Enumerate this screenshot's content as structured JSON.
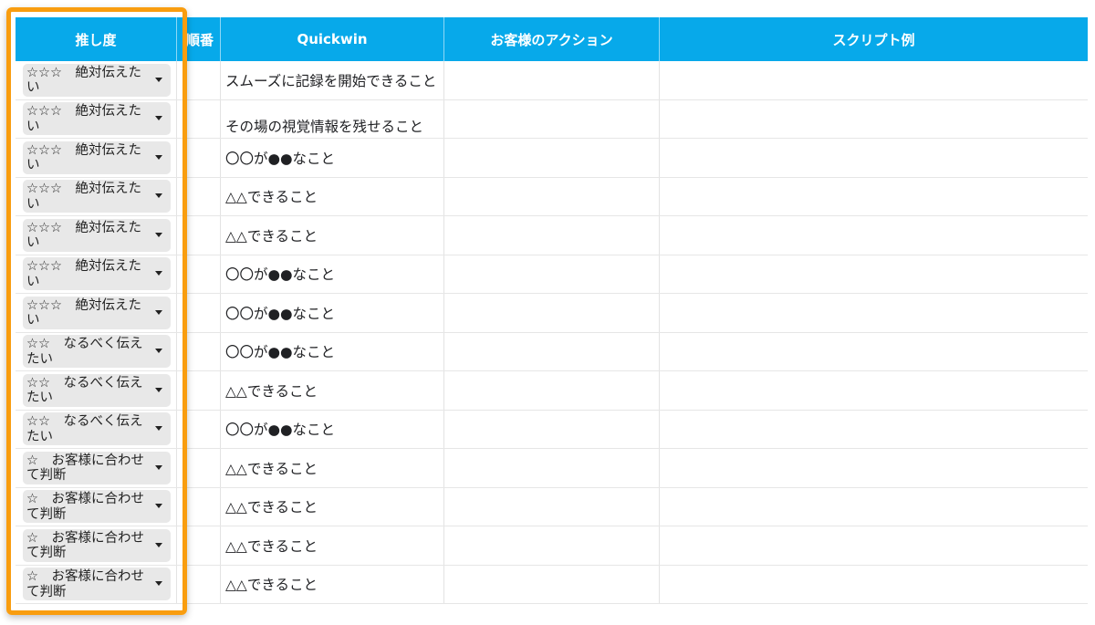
{
  "headers": {
    "priority": "推し度",
    "order": "順番",
    "quickwin": "Quickwin",
    "customer_action": "お客様のアクション",
    "script_example": "スクリプト例"
  },
  "colors": {
    "header_bg": "#07a9ea",
    "highlight": "#f99d0f",
    "dropdown_bg": "#e8e8e8"
  },
  "rows": [
    {
      "priority": "☆☆☆　絶対伝えたい",
      "quickwin": "スムーズに記録を開始できること"
    },
    {
      "priority": "☆☆☆　絶対伝えたい",
      "quickwin": "その場の視覚情報を残せること"
    },
    {
      "priority": "☆☆☆　絶対伝えたい",
      "quickwin": "〇〇が●●なこと"
    },
    {
      "priority": "☆☆☆　絶対伝えたい",
      "quickwin": "△△できること"
    },
    {
      "priority": "☆☆☆　絶対伝えたい",
      "quickwin": "△△できること"
    },
    {
      "priority": "☆☆☆　絶対伝えたい",
      "quickwin": "〇〇が●●なこと"
    },
    {
      "priority": "☆☆☆　絶対伝えたい",
      "quickwin": "〇〇が●●なこと"
    },
    {
      "priority": "☆☆　なるべく伝えたい",
      "quickwin": "〇〇が●●なこと"
    },
    {
      "priority": "☆☆　なるべく伝えたい",
      "quickwin": "△△できること"
    },
    {
      "priority": "☆☆　なるべく伝えたい",
      "quickwin": "〇〇が●●なこと"
    },
    {
      "priority": "☆　お客様に合わせて判断",
      "quickwin": "△△できること"
    },
    {
      "priority": "☆　お客様に合わせて判断",
      "quickwin": "△△できること"
    },
    {
      "priority": "☆　お客様に合わせて判断",
      "quickwin": "△△できること"
    },
    {
      "priority": "☆　お客様に合わせて判断",
      "quickwin": "△△できること"
    }
  ]
}
